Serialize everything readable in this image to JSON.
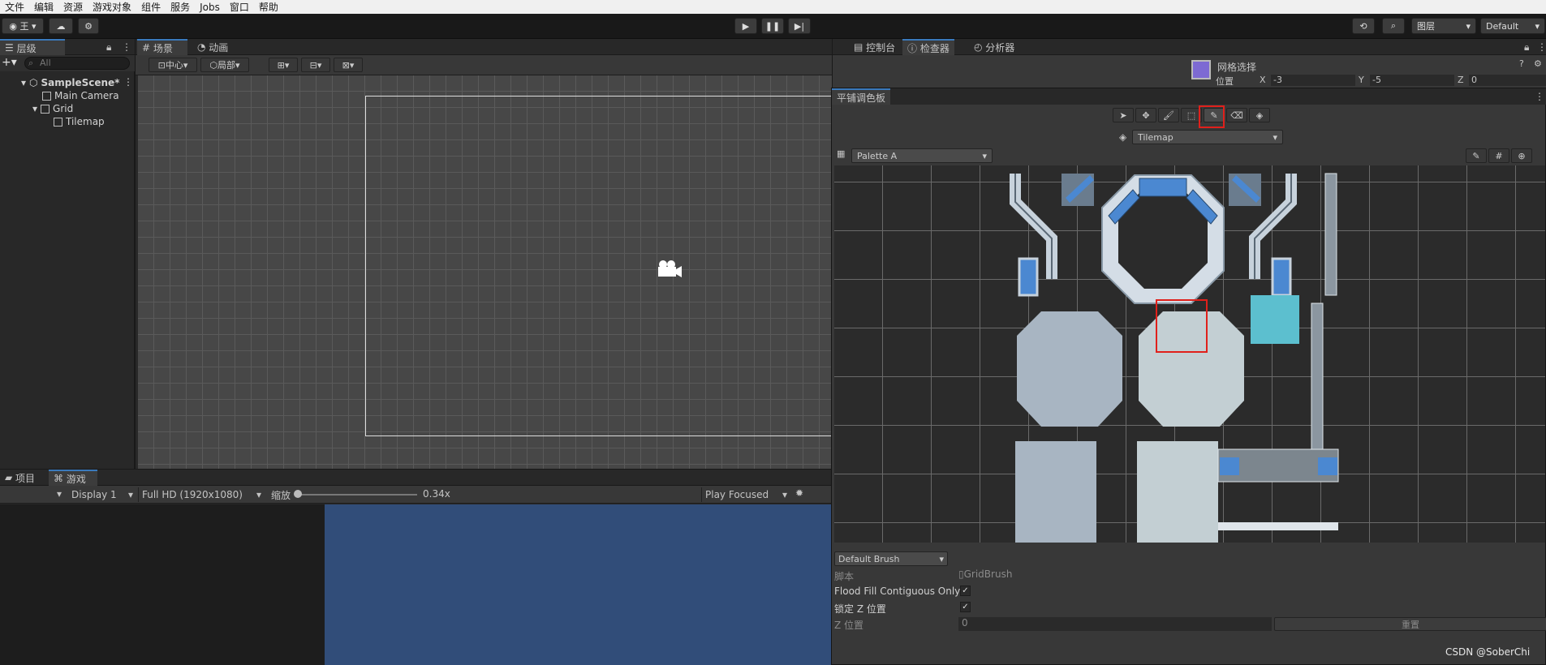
{
  "menu": [
    "文件",
    "编辑",
    "资源",
    "游戏对象",
    "组件",
    "服务",
    "Jobs",
    "窗口",
    "帮助"
  ],
  "toolbar": {
    "account_label": "王",
    "layers_label": "图层",
    "layout_label": "Default"
  },
  "hierarchy": {
    "tab": "层级",
    "search_placeholder": "All",
    "items": [
      {
        "label": "SampleScene*"
      },
      {
        "label": "Main Camera"
      },
      {
        "label": "Grid"
      },
      {
        "label": "Tilemap"
      }
    ]
  },
  "scene": {
    "tabs": [
      "场景",
      "动画"
    ],
    "pivot_label": "中心",
    "space_label": "局部",
    "mode_2d": "2D"
  },
  "bottom": {
    "tabs": [
      "项目",
      "游戏"
    ],
    "display": "Display 1",
    "resolution": "Full HD (1920x1080)",
    "scale_label": "缩放",
    "scale_value": "0.34x",
    "scale_fraction": 0.0,
    "play_mode": "Play Focused"
  },
  "inspector": {
    "tabs": [
      "控制台",
      "检查器",
      "分析器"
    ],
    "title": "网格选择",
    "position_label": "位置",
    "x_label": "X",
    "x_value": "-3",
    "y_label": "Y",
    "y_value": "-5",
    "z_label": "Z",
    "z_value": "0"
  },
  "palette": {
    "title": "平铺调色板",
    "target": "Tilemap",
    "palette_name": "Palette A",
    "brush": "Default Brush",
    "script_label": "脚本",
    "script_value": "GridBrush",
    "flood_label": "Flood Fill Contiguous Only",
    "lockz_label": "锁定 Z 位置",
    "zpos_label": "Z 位置",
    "zpos_value": "0",
    "reset_label": "重置",
    "highlight_color": "#e0201b"
  },
  "watermark": "CSDN @SoberChi"
}
